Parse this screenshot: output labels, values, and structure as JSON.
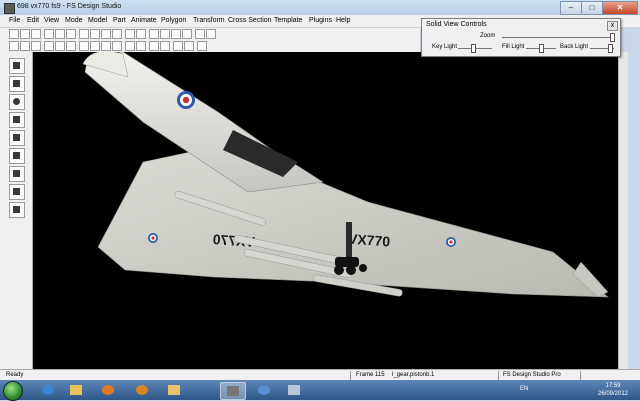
{
  "window": {
    "title": "698 vx770 fs9 - FS Design Studio",
    "min": "–",
    "max": "□",
    "close": "✕"
  },
  "menu": [
    "File",
    "Edit",
    "View",
    "Mode",
    "Model",
    "Part",
    "Animate",
    "Polygon",
    "Transform",
    "Cross Section",
    "Template",
    "Plugins",
    "Help"
  ],
  "solid_view_controls": {
    "title": "Solid View Controls",
    "close": "x",
    "zoom_label": "Zoom",
    "key_light_label": "Key Light",
    "fill_light_label": "Fill Light",
    "back_light_label": "Back Light",
    "zoom_level": 0.98,
    "key_light_level": 0.45,
    "fill_light_level": 0.5,
    "back_light_level": 0.82
  },
  "viewport": {
    "aircraft_serial": "VX770",
    "background": "#000000"
  },
  "status": {
    "ready": "Ready",
    "frame": "Frame 115",
    "part": "l_gear.pistonb.1",
    "product": "FS Design Studio Pro"
  },
  "taskbar": {
    "language": "EN",
    "time": "17:59",
    "date": "26/09/2012"
  },
  "icons": [
    "start-orb",
    "ie-icon",
    "folder-icon",
    "media-icon",
    "firefox-icon",
    "explorer-icon",
    "fsds-icon",
    "paint-icon",
    "plug-icon"
  ]
}
